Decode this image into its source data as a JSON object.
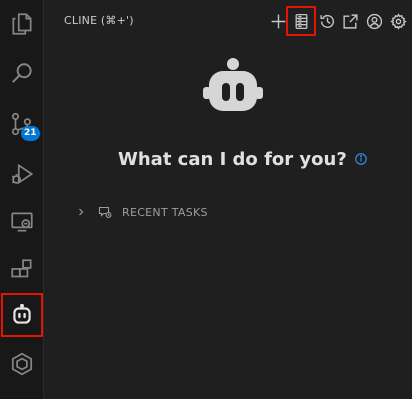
{
  "activity_bar": {
    "items": [
      {
        "name": "explorer",
        "icon": "files-icon"
      },
      {
        "name": "search",
        "icon": "search-icon"
      },
      {
        "name": "source-control",
        "icon": "source-control-icon",
        "badge": "21"
      },
      {
        "name": "run-debug",
        "icon": "run-debug-icon"
      },
      {
        "name": "remote-explorer",
        "icon": "remote-explorer-icon"
      },
      {
        "name": "extensions",
        "icon": "extensions-icon"
      },
      {
        "name": "cline",
        "icon": "cline-robot-icon",
        "highlighted": true
      },
      {
        "name": "other-extension",
        "icon": "hexagon-icon"
      }
    ]
  },
  "header": {
    "title": "CLINE (⌘+')",
    "actions": [
      {
        "name": "new-task",
        "icon": "plus-icon"
      },
      {
        "name": "mcp-servers",
        "icon": "server-icon",
        "highlighted": true
      },
      {
        "name": "history",
        "icon": "history-icon"
      },
      {
        "name": "popout",
        "icon": "link-external-icon"
      },
      {
        "name": "account",
        "icon": "account-icon"
      },
      {
        "name": "settings",
        "icon": "gear-icon"
      }
    ]
  },
  "main": {
    "welcome_text": "What can I do for you?",
    "recent_tasks_label": "RECENT TASKS"
  },
  "colors": {
    "background": "#1f1f1f",
    "activity_bar": "#181818",
    "icon": "#c5c5c5",
    "badge": "#0078d4",
    "highlight": "#e51400"
  }
}
